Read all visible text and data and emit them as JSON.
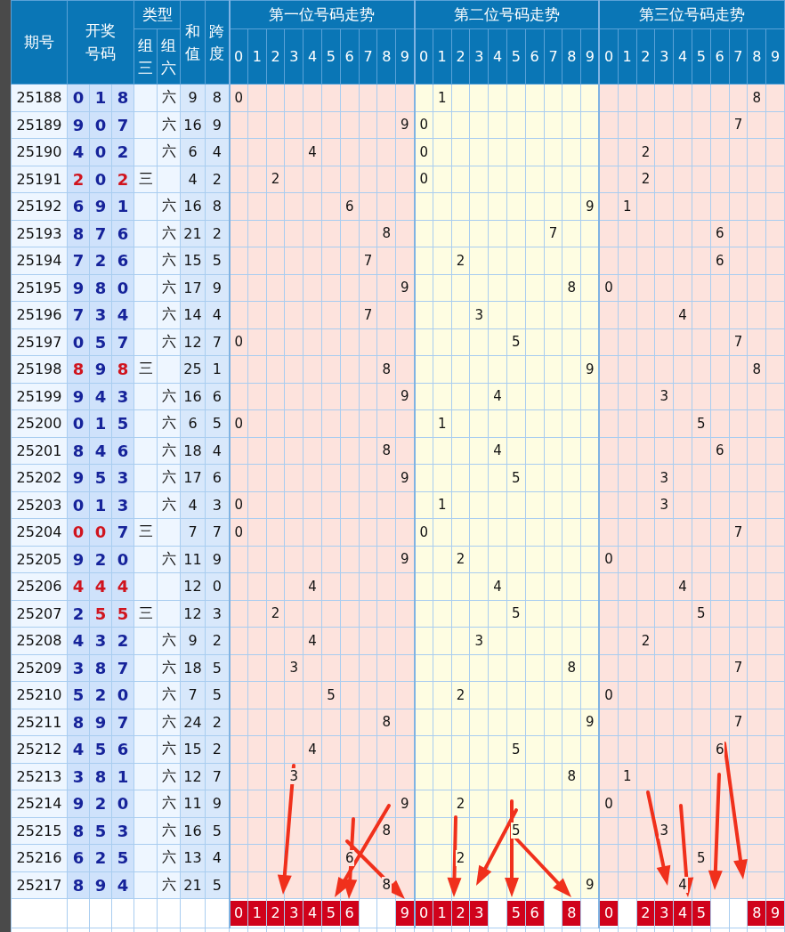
{
  "header": {
    "period": "期号",
    "draw": "开奖号码",
    "type": "类型",
    "type_three": "组三",
    "type_six": "组六",
    "sum": "和值",
    "span": "跨度",
    "groups": [
      {
        "title": "第一位号码走势",
        "columns": [
          "0",
          "1",
          "2",
          "3",
          "4",
          "5",
          "6",
          "7",
          "8",
          "9"
        ]
      },
      {
        "title": "第二位号码走势",
        "columns": [
          "0",
          "1",
          "2",
          "3",
          "4",
          "5",
          "6",
          "7",
          "8",
          "9"
        ]
      },
      {
        "title": "第三位号码走势",
        "columns": [
          "0",
          "1",
          "2",
          "3",
          "4",
          "5",
          "6",
          "7",
          "8",
          "9"
        ]
      }
    ]
  },
  "rows": [
    {
      "period": "25188",
      "draw": [
        {
          "digit": "0",
          "repeated": false
        },
        {
          "digit": "1",
          "repeated": false
        },
        {
          "digit": "8",
          "repeated": false
        }
      ],
      "type": {
        "kind": "six",
        "label": "六"
      },
      "sum": "9",
      "span": "8",
      "trend": [
        {
          "col_0": "0"
        },
        {
          "col_1": "1"
        },
        {
          "col_8": "8"
        }
      ]
    },
    {
      "period": "25189",
      "draw": [
        {
          "digit": "9",
          "repeated": false
        },
        {
          "digit": "0",
          "repeated": false
        },
        {
          "digit": "7",
          "repeated": false
        }
      ],
      "type": {
        "kind": "six",
        "label": "六"
      },
      "sum": "16",
      "span": "9",
      "trend": [
        {
          "col_9": "9"
        },
        {
          "col_0": "0"
        },
        {
          "col_7": "7"
        }
      ]
    },
    {
      "period": "25190",
      "draw": [
        {
          "digit": "4",
          "repeated": false
        },
        {
          "digit": "0",
          "repeated": false
        },
        {
          "digit": "2",
          "repeated": false
        }
      ],
      "type": {
        "kind": "six",
        "label": "六"
      },
      "sum": "6",
      "span": "4",
      "trend": [
        {
          "col_4": "4"
        },
        {
          "col_0": "0"
        },
        {
          "col_2": "2"
        }
      ]
    },
    {
      "period": "25191",
      "draw": [
        {
          "digit": "2",
          "repeated": true
        },
        {
          "digit": "0",
          "repeated": false
        },
        {
          "digit": "2",
          "repeated": true
        }
      ],
      "type": {
        "kind": "three",
        "label": "三"
      },
      "sum": "4",
      "span": "2",
      "trend": [
        {
          "col_2": "2"
        },
        {
          "col_0": "0"
        },
        {
          "col_2": "2"
        }
      ]
    },
    {
      "period": "25192",
      "draw": [
        {
          "digit": "6",
          "repeated": false
        },
        {
          "digit": "9",
          "repeated": false
        },
        {
          "digit": "1",
          "repeated": false
        }
      ],
      "type": {
        "kind": "six",
        "label": "六"
      },
      "sum": "16",
      "span": "8",
      "trend": [
        {
          "col_6": "6"
        },
        {
          "col_9": "9"
        },
        {
          "col_1": "1"
        }
      ]
    },
    {
      "period": "25193",
      "draw": [
        {
          "digit": "8",
          "repeated": false
        },
        {
          "digit": "7",
          "repeated": false
        },
        {
          "digit": "6",
          "repeated": false
        }
      ],
      "type": {
        "kind": "six",
        "label": "六"
      },
      "sum": "21",
      "span": "2",
      "trend": [
        {
          "col_8": "8"
        },
        {
          "col_7": "7"
        },
        {
          "col_6": "6"
        }
      ]
    },
    {
      "period": "25194",
      "draw": [
        {
          "digit": "7",
          "repeated": false
        },
        {
          "digit": "2",
          "repeated": false
        },
        {
          "digit": "6",
          "repeated": false
        }
      ],
      "type": {
        "kind": "six",
        "label": "六"
      },
      "sum": "15",
      "span": "5",
      "trend": [
        {
          "col_7": "7"
        },
        {
          "col_2": "2"
        },
        {
          "col_6": "6"
        }
      ]
    },
    {
      "period": "25195",
      "draw": [
        {
          "digit": "9",
          "repeated": false
        },
        {
          "digit": "8",
          "repeated": false
        },
        {
          "digit": "0",
          "repeated": false
        }
      ],
      "type": {
        "kind": "six",
        "label": "六"
      },
      "sum": "17",
      "span": "9",
      "trend": [
        {
          "col_9": "9"
        },
        {
          "col_8": "8"
        },
        {
          "col_0": "0"
        }
      ]
    },
    {
      "period": "25196",
      "draw": [
        {
          "digit": "7",
          "repeated": false
        },
        {
          "digit": "3",
          "repeated": false
        },
        {
          "digit": "4",
          "repeated": false
        }
      ],
      "type": {
        "kind": "six",
        "label": "六"
      },
      "sum": "14",
      "span": "4",
      "trend": [
        {
          "col_7": "7"
        },
        {
          "col_3": "3"
        },
        {
          "col_4": "4"
        }
      ]
    },
    {
      "period": "25197",
      "draw": [
        {
          "digit": "0",
          "repeated": false
        },
        {
          "digit": "5",
          "repeated": false
        },
        {
          "digit": "7",
          "repeated": false
        }
      ],
      "type": {
        "kind": "six",
        "label": "六"
      },
      "sum": "12",
      "span": "7",
      "trend": [
        {
          "col_0": "0"
        },
        {
          "col_5": "5"
        },
        {
          "col_7": "7"
        }
      ]
    },
    {
      "period": "25198",
      "draw": [
        {
          "digit": "8",
          "repeated": true
        },
        {
          "digit": "9",
          "repeated": false
        },
        {
          "digit": "8",
          "repeated": true
        }
      ],
      "type": {
        "kind": "three",
        "label": "三"
      },
      "sum": "25",
      "span": "1",
      "trend": [
        {
          "col_8": "8"
        },
        {
          "col_9": "9"
        },
        {
          "col_8": "8"
        }
      ]
    },
    {
      "period": "25199",
      "draw": [
        {
          "digit": "9",
          "repeated": false
        },
        {
          "digit": "4",
          "repeated": false
        },
        {
          "digit": "3",
          "repeated": false
        }
      ],
      "type": {
        "kind": "six",
        "label": "六"
      },
      "sum": "16",
      "span": "6",
      "trend": [
        {
          "col_9": "9"
        },
        {
          "col_4": "4"
        },
        {
          "col_3": "3"
        }
      ]
    },
    {
      "period": "25200",
      "draw": [
        {
          "digit": "0",
          "repeated": false
        },
        {
          "digit": "1",
          "repeated": false
        },
        {
          "digit": "5",
          "repeated": false
        }
      ],
      "type": {
        "kind": "six",
        "label": "六"
      },
      "sum": "6",
      "span": "5",
      "trend": [
        {
          "col_0": "0"
        },
        {
          "col_1": "1"
        },
        {
          "col_5": "5"
        }
      ]
    },
    {
      "period": "25201",
      "draw": [
        {
          "digit": "8",
          "repeated": false
        },
        {
          "digit": "4",
          "repeated": false
        },
        {
          "digit": "6",
          "repeated": false
        }
      ],
      "type": {
        "kind": "six",
        "label": "六"
      },
      "sum": "18",
      "span": "4",
      "trend": [
        {
          "col_8": "8"
        },
        {
          "col_4": "4"
        },
        {
          "col_6": "6"
        }
      ]
    },
    {
      "period": "25202",
      "draw": [
        {
          "digit": "9",
          "repeated": false
        },
        {
          "digit": "5",
          "repeated": false
        },
        {
          "digit": "3",
          "repeated": false
        }
      ],
      "type": {
        "kind": "six",
        "label": "六"
      },
      "sum": "17",
      "span": "6",
      "trend": [
        {
          "col_9": "9"
        },
        {
          "col_5": "5"
        },
        {
          "col_3": "3"
        }
      ]
    },
    {
      "period": "25203",
      "draw": [
        {
          "digit": "0",
          "repeated": false
        },
        {
          "digit": "1",
          "repeated": false
        },
        {
          "digit": "3",
          "repeated": false
        }
      ],
      "type": {
        "kind": "six",
        "label": "六"
      },
      "sum": "4",
      "span": "3",
      "trend": [
        {
          "col_0": "0"
        },
        {
          "col_1": "1"
        },
        {
          "col_3": "3"
        }
      ]
    },
    {
      "period": "25204",
      "draw": [
        {
          "digit": "0",
          "repeated": true
        },
        {
          "digit": "0",
          "repeated": true
        },
        {
          "digit": "7",
          "repeated": false
        }
      ],
      "type": {
        "kind": "three",
        "label": "三"
      },
      "sum": "7",
      "span": "7",
      "trend": [
        {
          "col_0": "0"
        },
        {
          "col_0": "0"
        },
        {
          "col_7": "7"
        }
      ]
    },
    {
      "period": "25205",
      "draw": [
        {
          "digit": "9",
          "repeated": false
        },
        {
          "digit": "2",
          "repeated": false
        },
        {
          "digit": "0",
          "repeated": false
        }
      ],
      "type": {
        "kind": "six",
        "label": "六"
      },
      "sum": "11",
      "span": "9",
      "trend": [
        {
          "col_9": "9"
        },
        {
          "col_2": "2"
        },
        {
          "col_0": "0"
        }
      ]
    },
    {
      "period": "25206",
      "draw": [
        {
          "digit": "4",
          "repeated": true
        },
        {
          "digit": "4",
          "repeated": true
        },
        {
          "digit": "4",
          "repeated": true
        }
      ],
      "sum": "12",
      "span": "0",
      "trend": [
        {
          "col_4": "4"
        },
        {
          "col_4": "4"
        },
        {
          "col_4": "4"
        }
      ]
    },
    {
      "period": "25207",
      "draw": [
        {
          "digit": "2",
          "repeated": false
        },
        {
          "digit": "5",
          "repeated": true
        },
        {
          "digit": "5",
          "repeated": true
        }
      ],
      "type": {
        "kind": "three",
        "label": "三"
      },
      "sum": "12",
      "span": "3",
      "trend": [
        {
          "col_2": "2"
        },
        {
          "col_5": "5"
        },
        {
          "col_5": "5"
        }
      ]
    },
    {
      "period": "25208",
      "draw": [
        {
          "digit": "4",
          "repeated": false
        },
        {
          "digit": "3",
          "repeated": false
        },
        {
          "digit": "2",
          "repeated": false
        }
      ],
      "type": {
        "kind": "six",
        "label": "六"
      },
      "sum": "9",
      "span": "2",
      "trend": [
        {
          "col_4": "4"
        },
        {
          "col_3": "3"
        },
        {
          "col_2": "2"
        }
      ]
    },
    {
      "period": "25209",
      "draw": [
        {
          "digit": "3",
          "repeated": false
        },
        {
          "digit": "8",
          "repeated": false
        },
        {
          "digit": "7",
          "repeated": false
        }
      ],
      "type": {
        "kind": "six",
        "label": "六"
      },
      "sum": "18",
      "span": "5",
      "trend": [
        {
          "col_3": "3"
        },
        {
          "col_8": "8"
        },
        {
          "col_7": "7"
        }
      ]
    },
    {
      "period": "25210",
      "draw": [
        {
          "digit": "5",
          "repeated": false
        },
        {
          "digit": "2",
          "repeated": false
        },
        {
          "digit": "0",
          "repeated": false
        }
      ],
      "type": {
        "kind": "six",
        "label": "六"
      },
      "sum": "7",
      "span": "5",
      "trend": [
        {
          "col_5": "5"
        },
        {
          "col_2": "2"
        },
        {
          "col_0": "0"
        }
      ]
    },
    {
      "period": "25211",
      "draw": [
        {
          "digit": "8",
          "repeated": false
        },
        {
          "digit": "9",
          "repeated": false
        },
        {
          "digit": "7",
          "repeated": false
        }
      ],
      "type": {
        "kind": "six",
        "label": "六"
      },
      "sum": "24",
      "span": "2",
      "trend": [
        {
          "col_8": "8"
        },
        {
          "col_9": "9"
        },
        {
          "col_7": "7"
        }
      ]
    },
    {
      "period": "25212",
      "draw": [
        {
          "digit": "4",
          "repeated": false
        },
        {
          "digit": "5",
          "repeated": false
        },
        {
          "digit": "6",
          "repeated": false
        }
      ],
      "type": {
        "kind": "six",
        "label": "六"
      },
      "sum": "15",
      "span": "2",
      "trend": [
        {
          "col_4": "4"
        },
        {
          "col_5": "5"
        },
        {
          "col_6": "6"
        }
      ]
    },
    {
      "period": "25213",
      "draw": [
        {
          "digit": "3",
          "repeated": false
        },
        {
          "digit": "8",
          "repeated": false
        },
        {
          "digit": "1",
          "repeated": false
        }
      ],
      "type": {
        "kind": "six",
        "label": "六"
      },
      "sum": "12",
      "span": "7",
      "trend": [
        {
          "col_3": "3"
        },
        {
          "col_8": "8"
        },
        {
          "col_1": "1"
        }
      ]
    },
    {
      "period": "25214",
      "draw": [
        {
          "digit": "9",
          "repeated": false
        },
        {
          "digit": "2",
          "repeated": false
        },
        {
          "digit": "0",
          "repeated": false
        }
      ],
      "type": {
        "kind": "six",
        "label": "六"
      },
      "sum": "11",
      "span": "9",
      "trend": [
        {
          "col_9": "9"
        },
        {
          "col_2": "2"
        },
        {
          "col_0": "0"
        }
      ]
    },
    {
      "period": "25215",
      "draw": [
        {
          "digit": "8",
          "repeated": false
        },
        {
          "digit": "5",
          "repeated": false
        },
        {
          "digit": "3",
          "repeated": false
        }
      ],
      "type": {
        "kind": "six",
        "label": "六"
      },
      "sum": "16",
      "span": "5",
      "trend": [
        {
          "col_8": "8"
        },
        {
          "col_5": "5"
        },
        {
          "col_3": "3"
        }
      ]
    },
    {
      "period": "25216",
      "draw": [
        {
          "digit": "6",
          "repeated": false
        },
        {
          "digit": "2",
          "repeated": false
        },
        {
          "digit": "5",
          "repeated": false
        }
      ],
      "type": {
        "kind": "six",
        "label": "六"
      },
      "sum": "13",
      "span": "4",
      "trend": [
        {
          "col_6": "6"
        },
        {
          "col_2": "2"
        },
        {
          "col_5": "5"
        }
      ]
    },
    {
      "period": "25217",
      "draw": [
        {
          "digit": "8",
          "repeated": false
        },
        {
          "digit": "9",
          "repeated": false
        },
        {
          "digit": "4",
          "repeated": false
        }
      ],
      "type": {
        "kind": "six",
        "label": "六"
      },
      "sum": "21",
      "span": "5",
      "trend": [
        {
          "col_8": "8"
        },
        {
          "col_9": "9"
        },
        {
          "col_4": "4"
        }
      ]
    }
  ],
  "tally": [
    {
      "col_0": "0",
      "col_1": "1",
      "col_2": "2",
      "col_3": "3",
      "col_4": "4",
      "col_5": "5",
      "col_6": "6",
      "col_9": "9"
    },
    {
      "col_0": "0",
      "col_1": "1",
      "col_2": "2",
      "col_3": "3",
      "col_5": "5",
      "col_6": "6",
      "col_8": "8"
    },
    {
      "col_0": "0",
      "col_2": "2",
      "col_3": "3",
      "col_4": "4",
      "col_5": "5",
      "col_8": "8",
      "col_9": "9"
    }
  ]
}
